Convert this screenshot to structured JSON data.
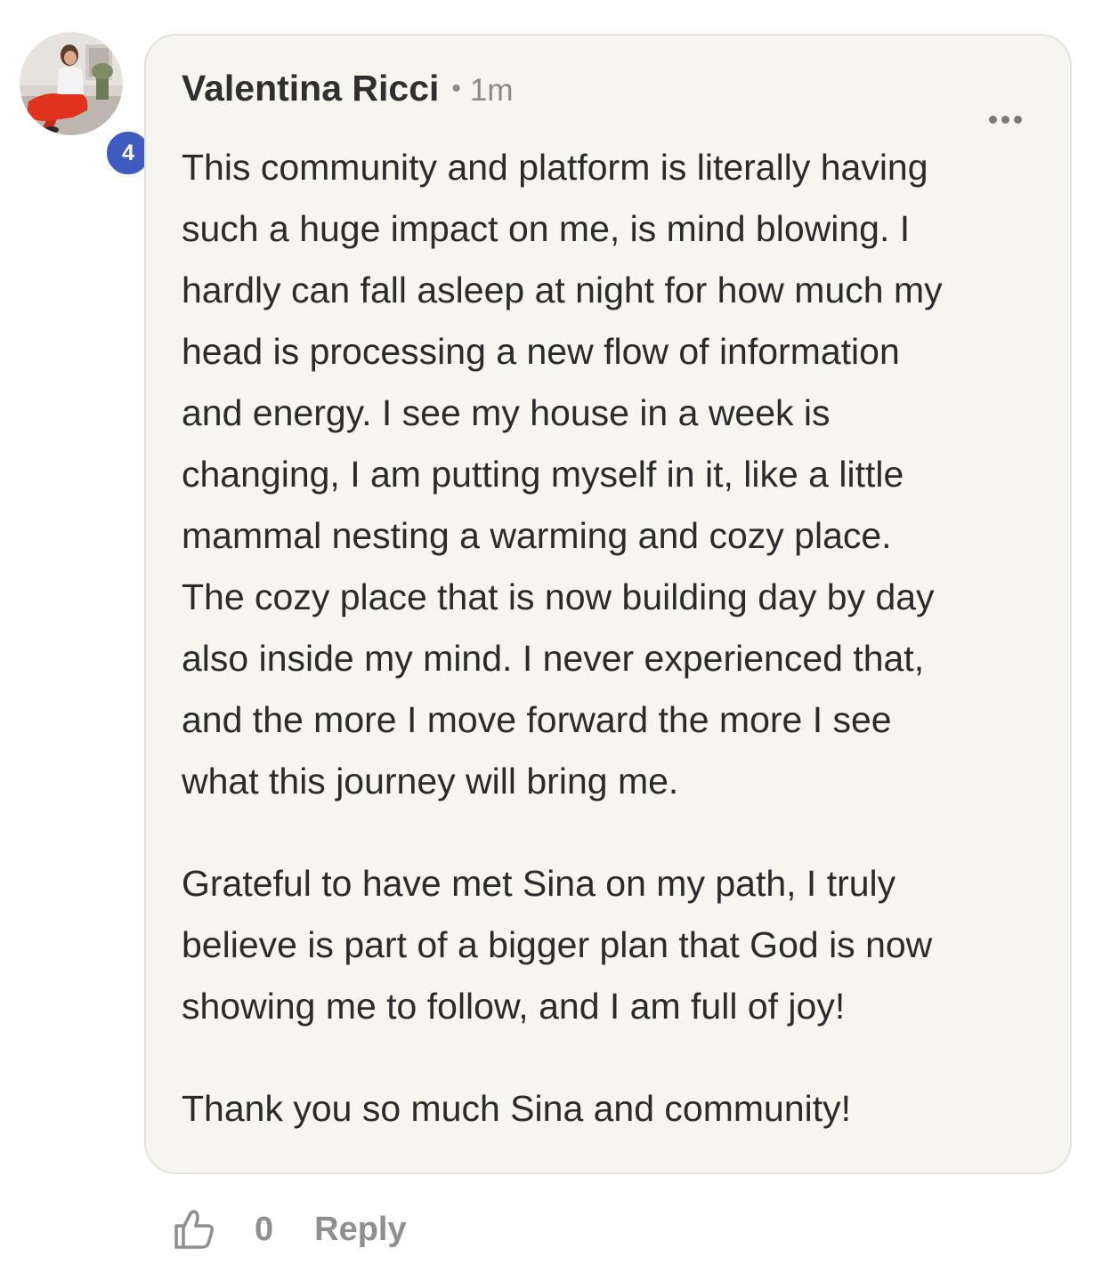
{
  "comment": {
    "avatar_icon": "user-photo-avatar",
    "level_badge": "4",
    "author": "Valentina Ricci",
    "separator": "•",
    "time": "1m",
    "more_icon": "ellipsis-icon",
    "paragraphs": [
      {
        "lines": [
          "This community and platform is literally having",
          "such a huge impact on me, is mind blowing. I",
          "hardly can fall asleep at night for how much my",
          "head is processing a new flow of information",
          "and energy. I see my house in a week is",
          "changing, I am putting myself in it, like a little",
          "mammal nesting a warming and cozy place.",
          "The cozy place that is now building day by day",
          "also inside my mind. I never experienced that,",
          "and the more I move forward the more I see",
          "what this journey will bring me."
        ]
      },
      {
        "lines": [
          "Grateful to have met Sina on my path, I truly",
          "believe is part of a bigger plan that God is now",
          "showing me to follow, and I am full of joy!"
        ]
      },
      {
        "lines": [
          "Thank you so much Sina and community!"
        ]
      }
    ]
  },
  "actions": {
    "like_icon": "thumbs-up-icon",
    "like_count": "0",
    "reply_label": "Reply"
  },
  "colors": {
    "bubble_bg": "#f7f5ef",
    "badge": "#3f5bbf",
    "muted_text": "#8f8f8f"
  }
}
